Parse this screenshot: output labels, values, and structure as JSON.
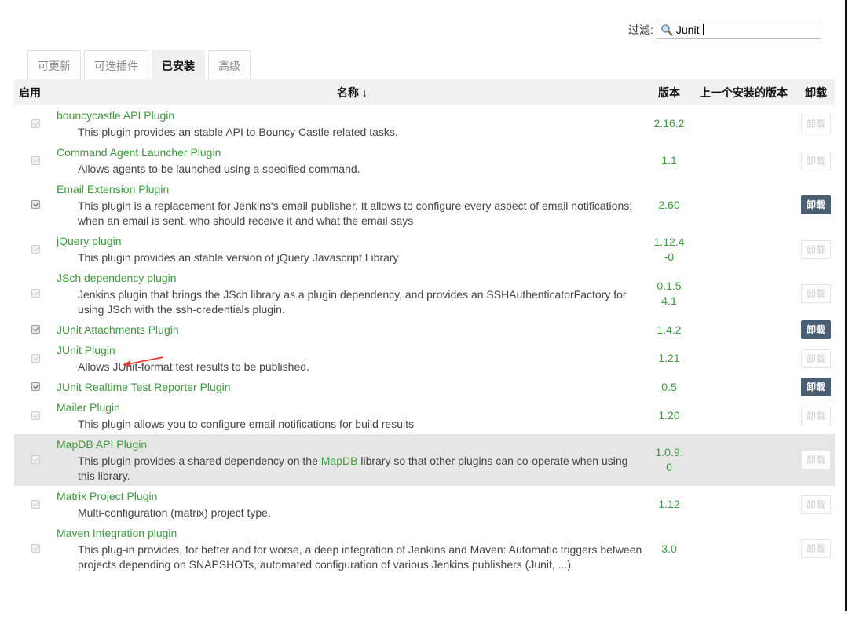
{
  "filter": {
    "label": "过滤:",
    "value": "Junit",
    "icon": "search-icon"
  },
  "tabs": [
    {
      "label": "可更新",
      "active": false
    },
    {
      "label": "可选插件",
      "active": false
    },
    {
      "label": "已安装",
      "active": true
    },
    {
      "label": "高级",
      "active": false
    }
  ],
  "table": {
    "headers": {
      "enabled": "启用",
      "name": "名称 ↓",
      "version": "版本",
      "previous": "上一个安装的版本",
      "uninstall": "卸载"
    },
    "uninstall_label": "卸载",
    "rows": [
      {
        "name": "bouncycastle API Plugin",
        "desc": "This plugin provides an stable API to Bouncy Castle related tasks.",
        "version": "2.16.2",
        "checked": false,
        "uninstall_enabled": false
      },
      {
        "name": "Command Agent Launcher Plugin",
        "desc": "Allows agents to be launched using a specified command.",
        "version": "1.1",
        "checked": false,
        "uninstall_enabled": false
      },
      {
        "name": "Email Extension Plugin",
        "desc": "This plugin is a replacement for Jenkins's email publisher. It allows to configure every aspect of email notifications: when an email is sent, who should receive it and what the email says",
        "version": "2.60",
        "checked": true,
        "uninstall_enabled": true
      },
      {
        "name": "jQuery plugin",
        "desc": "This plugin provides an stable version of jQuery Javascript Library",
        "version": "1.12.4-0",
        "checked": false,
        "uninstall_enabled": false
      },
      {
        "name": "JSch dependency plugin",
        "desc": "Jenkins plugin that brings the JSch library as a plugin dependency, and provides an SSHAuthenticatorFactory for using JSch with the ssh-credentials plugin.",
        "version": "0.1.54.1",
        "checked": false,
        "uninstall_enabled": false
      },
      {
        "name": "JUnit Attachments Plugin",
        "desc": "",
        "version": "1.4.2",
        "checked": true,
        "uninstall_enabled": true
      },
      {
        "name": "JUnit Plugin",
        "desc": "Allows JUnit-format test results to be published.",
        "version": "1.21",
        "checked": false,
        "uninstall_enabled": false,
        "annotated": true
      },
      {
        "name": "JUnit Realtime Test Reporter Plugin",
        "desc": "",
        "version": "0.5",
        "checked": true,
        "uninstall_enabled": true
      },
      {
        "name": "Mailer Plugin",
        "desc": "This plugin allows you to configure email notifications for build results",
        "version": "1.20",
        "checked": false,
        "uninstall_enabled": false
      },
      {
        "name": "MapDB API Plugin",
        "desc_before": "This plugin provides a shared dependency on the ",
        "desc_link": "MapDB",
        "desc_after": " library so that other plugins can co-operate when using this library.",
        "version": "1.0.9.0",
        "checked": false,
        "uninstall_enabled": false,
        "highlighted": true
      },
      {
        "name": "Matrix Project Plugin",
        "desc": "Multi-configuration (matrix) project type.",
        "version": "1.12",
        "checked": false,
        "uninstall_enabled": false
      },
      {
        "name": "Maven Integration plugin",
        "desc": "This plug-in provides, for better and for worse, a deep integration of Jenkins and Maven: Automatic triggers between projects depending on SNAPSHOTs, automated configuration of various Jenkins publishers (Junit, ...).",
        "version": "3.0",
        "checked": false,
        "uninstall_enabled": false
      }
    ]
  },
  "colors": {
    "link": "#3c9a3c",
    "button_active": "#4a5e74",
    "highlight_row": "#e6e6e6",
    "annotation_arrow": "#e53935"
  }
}
